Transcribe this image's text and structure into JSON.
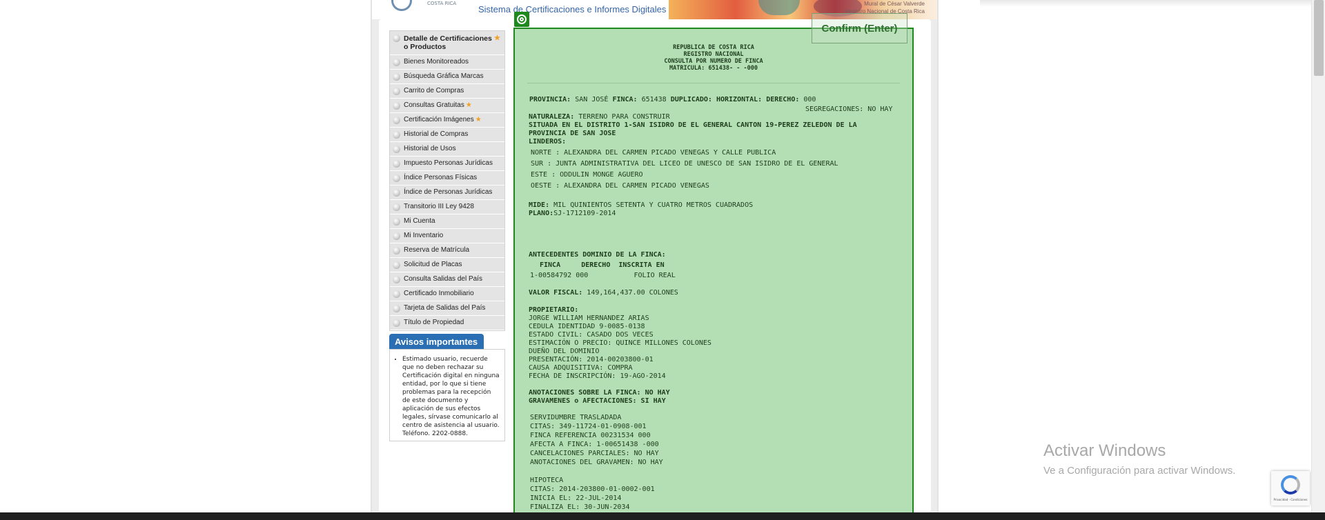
{
  "header": {
    "logo_text": "COSTA RICA",
    "site_title": "Sistema de Certificaciones e Informes Digitales",
    "mural_credit_1": "Mural de César Valverde",
    "mural_credit_2": "Registro Nacional de Costa Rica"
  },
  "sidebar": {
    "items": [
      {
        "label": "Detalle de Certificaciones o Productos",
        "starred": true
      },
      {
        "label": "Bienes Monitoreados"
      },
      {
        "label": "Búsqueda Gráfica Marcas"
      },
      {
        "label": "Carrito de Compras"
      },
      {
        "label": "Consultas Gratuitas",
        "starred": true
      },
      {
        "label": "Certificación Imágenes",
        "starred": true
      },
      {
        "label": "Historial de Compras"
      },
      {
        "label": "Historial de Usos"
      },
      {
        "label": "Impuesto Personas Jurídicas"
      },
      {
        "label": "Índice Personas Físicas"
      },
      {
        "label": "Índice de Personas Jurídicas"
      },
      {
        "label": "Transitorio III Ley 9428"
      },
      {
        "label": "Mi Cuenta"
      },
      {
        "label": "Mi Inventario"
      },
      {
        "label": "Reserva de Matrícula"
      },
      {
        "label": "Solicitud de Placas"
      },
      {
        "label": "Consulta Salidas del País"
      },
      {
        "label": "Certificado Inmobiliario"
      },
      {
        "label": "Tarjeta de Salidas del País"
      },
      {
        "label": "Título de Propiedad"
      }
    ],
    "star_glyph": "★"
  },
  "avisos": {
    "title": "Avisos importantes",
    "text": "Estimado usuario, recuerde que no deben rechazar su Certificación digital en ninguna entidad, por lo que si tiene problemas para la recepción de este documento y aplicación de sus efectos legales, sírvase comunicarlo al centro de asistencia al usuario. Teléfono. 2202-0888."
  },
  "confirm_button": "Confirm (Enter)",
  "document": {
    "head": [
      "REPUBLICA DE COSTA RICA",
      "REGISTRO NACIONAL",
      "CONSULTA POR NUMERO DE FINCA",
      "MATRICULA: 651438- - -000"
    ],
    "provincia_line": {
      "k1": "PROVINCIA:",
      "v1": " SAN JOSÉ ",
      "k2": "FINCA:",
      "v2": " 651438 ",
      "k3": "DUPLICADO: HORIZONTAL: DERECHO:",
      "v3": " 000"
    },
    "segregaciones": "SEGREGACIONES: NO HAY",
    "naturaleza_k": "NATURALEZA:",
    "naturaleza_v": " TERRENO PARA CONSTRUIR",
    "situada_1": "SITUADA EN EL DISTRITO 1-SAN ISIDRO DE EL GENERAL CANTON 19-PEREZ ZELEDON DE LA",
    "situada_2": "PROVINCIA DE SAN JOSE",
    "linderos": "LINDEROS:",
    "norte": "NORTE : ALEXANDRA DEL CARMEN PICADO VENEGAS Y CALLE PUBLICA",
    "sur": "SUR : JUNTA ADMINISTRATIVA DEL LICEO DE UNESCO DE SAN ISIDRO DE EL GENERAL",
    "este": "ESTE : ODDULIN MONGE AGUERO",
    "oeste": "OESTE : ALEXANDRA DEL CARMEN PICADO VENEGAS",
    "mide_k": "MIDE:",
    "mide_v": " MIL QUINIENTOS SETENTA Y CUATRO METROS CUADRADOS",
    "plano_k": "PLANO:",
    "plano_v": "SJ-1712109-2014",
    "antecedentes": "ANTECEDENTES DOMINIO DE LA FINCA:",
    "ant_cols": "FINCA     DERECHO  INSCRITA EN",
    "ant_row": "1-00584792 000           FOLIO REAL",
    "valor_k": "VALOR FISCAL:",
    "valor_v": " 149,164,437.00 COLONES",
    "propietario": "PROPIETARIO:",
    "prop_lines": [
      "JORGE WILLIAM HERNANDEZ ARIAS",
      "CEDULA IDENTIDAD 9-0085-0138",
      "ESTADO CIVIL: CASADO DOS VECES",
      "ESTIMACIÓN O PRECIO: QUINCE MILLONES COLONES",
      "DUEÑO DEL DOMINIO",
      "PRESENTACIÓN: 2014-00203800-01",
      "CAUSA ADQUISITIVA: COMPRA",
      "FECHA DE INSCRIPCIÓN: 19-AGO-2014"
    ],
    "anotaciones": "ANOTACIONES SOBRE LA FINCA: NO HAY",
    "gravamenes": "GRAVAMENES o AFECTACIONES: SI HAY",
    "serv_lines": [
      "SERVIDUMBRE TRASLADADA",
      "CITAS: 349-11724-01-0908-001",
      "FINCA REFERENCIA 00231534 000",
      "AFECTA A FINCA: 1-00651438 -000",
      "CANCELACIONES PARCIALES: NO HAY",
      "ANOTACIONES DEL GRAVAMEN: NO HAY"
    ],
    "hip_lines": [
      "HIPOTECA",
      "CITAS: 2014-203800-01-0002-001",
      "INICIA EL: 22-JUL-2014",
      "FINALIZA EL: 30-JUN-2034"
    ]
  },
  "watermark": {
    "title": "Activar Windows",
    "subtitle": "Ve a Configuración para activar Windows."
  },
  "recaptcha_text": "Privacidad - Condiciones"
}
